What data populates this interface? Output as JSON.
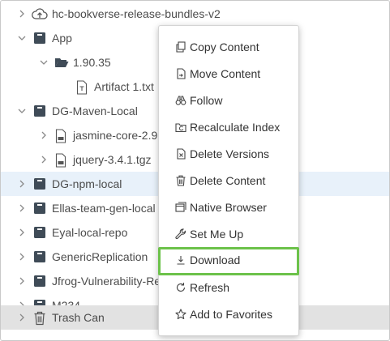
{
  "tree": {
    "rows": [
      {
        "label": "hc-bookverse-release-bundles-v2",
        "icon": "cloud-upload-icon"
      },
      {
        "label": "App",
        "icon": "repo-icon"
      },
      {
        "label": "1.90.35",
        "icon": "open-folder-icon"
      },
      {
        "label": "Artifact 1.txt",
        "icon": "text-file-icon"
      },
      {
        "label": "DG-Maven-Local",
        "icon": "repo-icon"
      },
      {
        "label": "jasmine-core-2.9",
        "icon": "archive-file-icon"
      },
      {
        "label": "jquery-3.4.1.tgz",
        "icon": "archive-file-icon"
      },
      {
        "label": "DG-npm-local",
        "icon": "repo-icon"
      },
      {
        "label": "Ellas-team-gen-local",
        "icon": "repo-icon"
      },
      {
        "label": "Eyal-local-repo",
        "icon": "repo-icon"
      },
      {
        "label": "GenericReplication",
        "icon": "repo-icon"
      },
      {
        "label": "Jfrog-Vulnerability-Re",
        "icon": "repo-icon"
      },
      {
        "label": "M234",
        "icon": "repo-icon"
      },
      {
        "label": "Trash Can",
        "icon": "trash-icon"
      }
    ]
  },
  "context_menu": {
    "items": [
      {
        "label": "Copy Content",
        "icon": "copy-icon"
      },
      {
        "label": "Move Content",
        "icon": "move-icon"
      },
      {
        "label": "Follow",
        "icon": "binoculars-icon"
      },
      {
        "label": "Recalculate Index",
        "icon": "folder-refresh-icon"
      },
      {
        "label": "Delete Versions",
        "icon": "delete-file-icon"
      },
      {
        "label": "Delete Content",
        "icon": "trash-icon"
      },
      {
        "label": "Native Browser",
        "icon": "window-icon"
      },
      {
        "label": "Set Me Up",
        "icon": "wrench-icon"
      },
      {
        "label": "Download",
        "icon": "download-icon"
      },
      {
        "label": "Refresh",
        "icon": "refresh-icon"
      },
      {
        "label": "Add to Favorites",
        "icon": "star-icon"
      }
    ]
  },
  "colors": {
    "selected_row": "#e8f1fa",
    "trash_row": "#e2e2e2",
    "highlight_border": "#6cc24a"
  }
}
